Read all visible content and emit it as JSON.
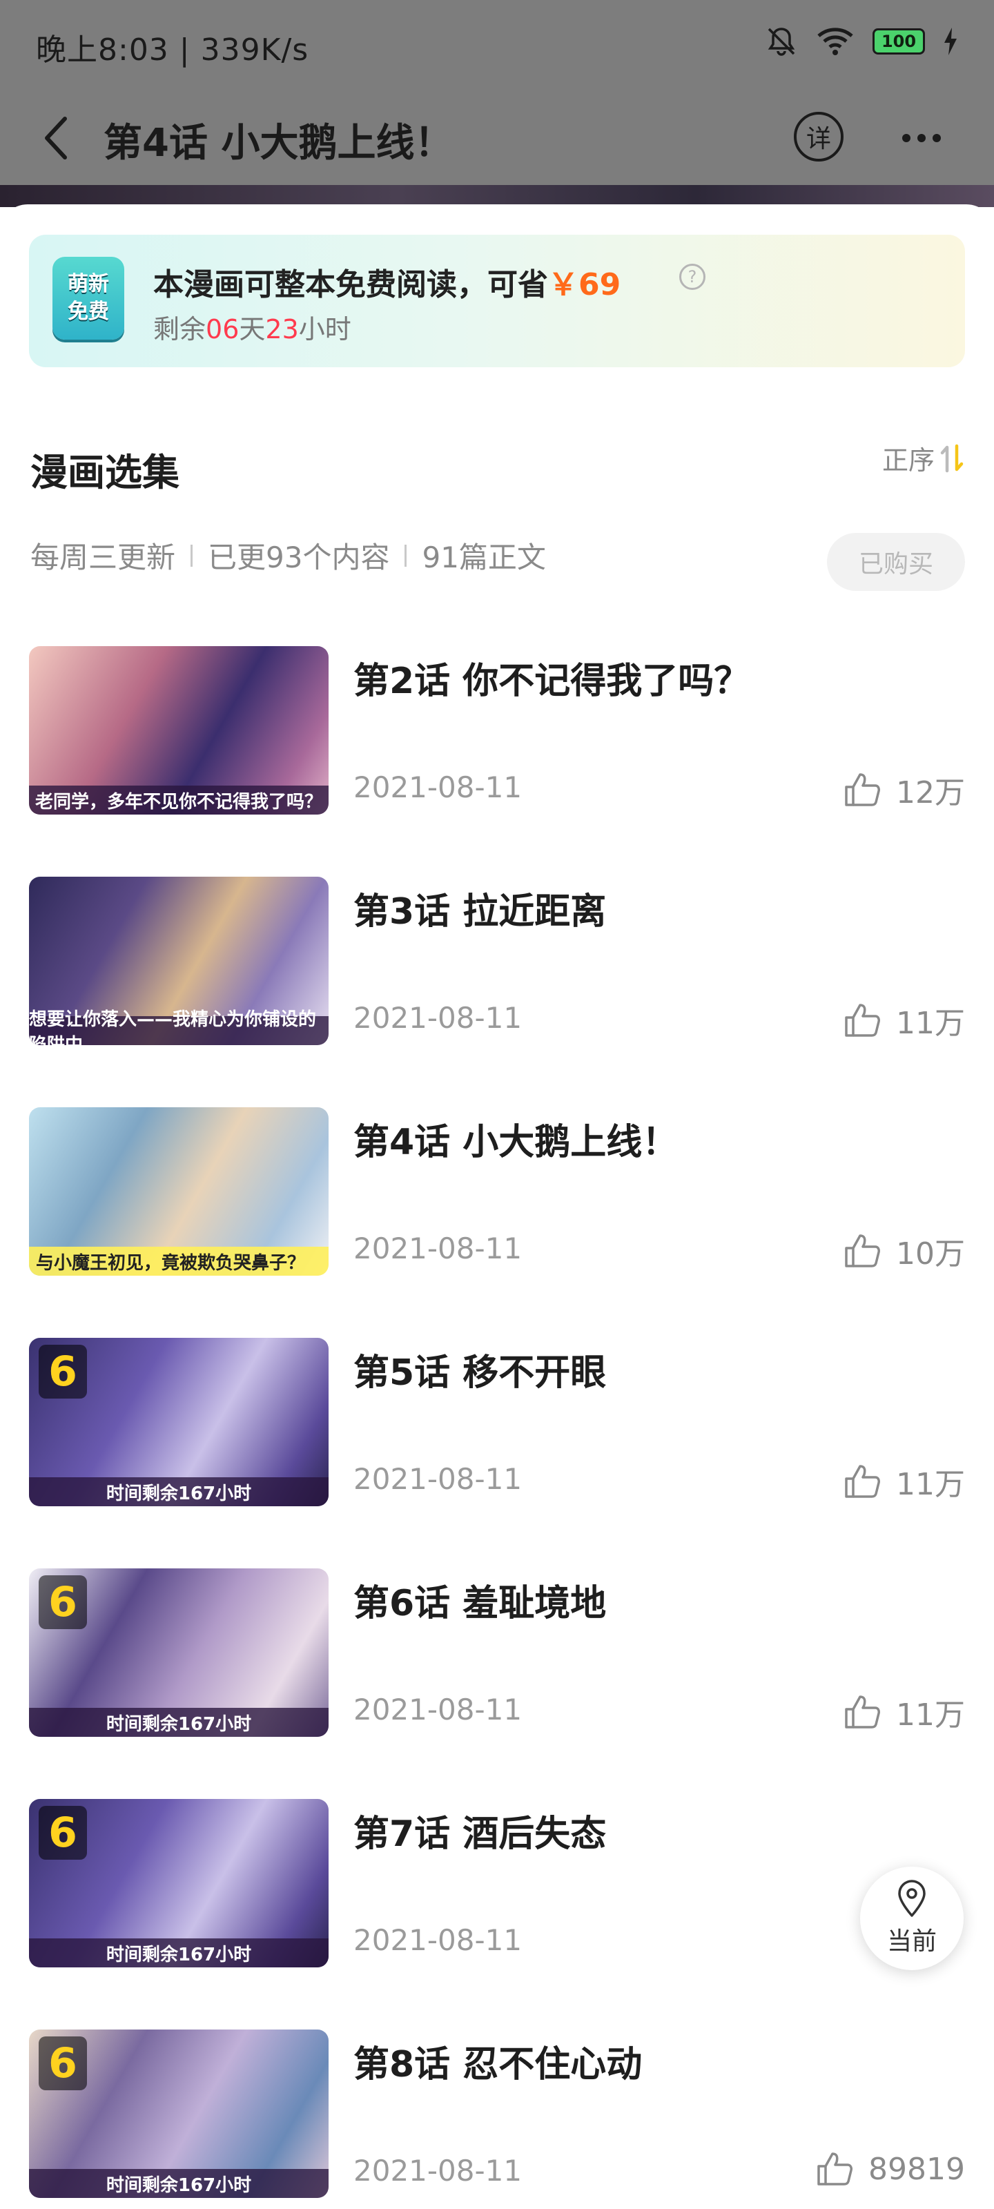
{
  "status_bar": {
    "time": "晚上8:03 | 339K/s",
    "battery": "100"
  },
  "nav": {
    "title": "第4话 小大鹅上线！",
    "detail_label": "详"
  },
  "promo": {
    "badge_line1": "萌新",
    "badge_line2": "免费",
    "title_prefix": "本漫画可整本免费阅读，可省",
    "price": "￥69",
    "help": "?",
    "remain_prefix": "剩余",
    "days": "06",
    "days_unit": "天",
    "hours": "23",
    "hours_unit": "小时"
  },
  "section": {
    "title": "漫画选集",
    "sort_label": "正序",
    "meta": [
      "每周三更新",
      "已更93个内容",
      "91篇正文"
    ],
    "bought_label": "已购买"
  },
  "episodes": [
    {
      "title": "第2话 你不记得我了吗？",
      "date": "2021-08-11",
      "likes": "12万",
      "caption": "老同学，多年不见你不记得我了吗？",
      "lock": ""
    },
    {
      "title": "第3话 拉近距离",
      "date": "2021-08-11",
      "likes": "11万",
      "caption": "想要让你落入——我精心为你铺设的陷阱中",
      "lock": ""
    },
    {
      "title": "第4话 小大鹅上线！",
      "date": "2021-08-11",
      "likes": "10万",
      "caption": "与小魔王初见，竟被欺负哭鼻子？",
      "lock": ""
    },
    {
      "title": "第5话 移不开眼",
      "date": "2021-08-11",
      "likes": "11万",
      "caption": "时间剩余167小时",
      "lock": "6"
    },
    {
      "title": "第6话 羞耻境地",
      "date": "2021-08-11",
      "likes": "11万",
      "caption": "时间剩余167小时",
      "lock": "6"
    },
    {
      "title": "第7话 酒后失态",
      "date": "2021-08-11",
      "likes": "",
      "caption": "时间剩余167小时",
      "lock": "6"
    },
    {
      "title": "第8话 忍不住心动",
      "date": "2021-08-11",
      "likes": "89819",
      "caption": "时间剩余167小时",
      "lock": "6"
    }
  ],
  "floating": {
    "current_label": "当前"
  },
  "colors": {
    "accent_orange": "#ff6a1a",
    "accent_red": "#ff3b4e",
    "sort_yellow": "#f5c518"
  }
}
